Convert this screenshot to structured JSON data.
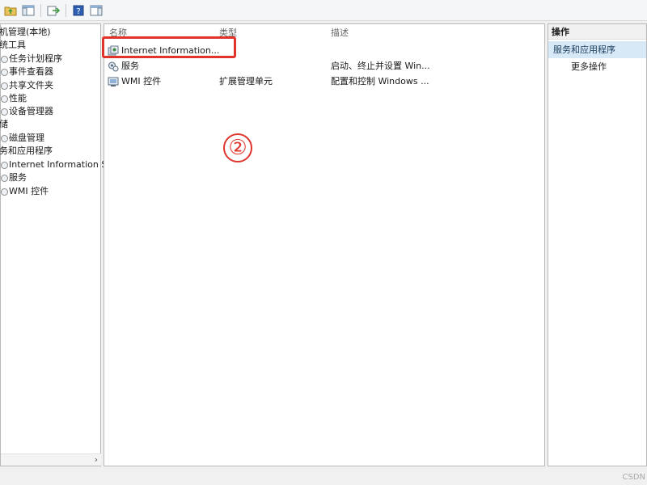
{
  "toolbar": {
    "icons": [
      "up-folder-icon",
      "console-tree-icon",
      "export-list-icon",
      "help-icon",
      "show-hide-action-pane-icon"
    ]
  },
  "tree": {
    "items": [
      {
        "label": "机管理(本地)",
        "icon": ""
      },
      {
        "label": "统工具",
        "icon": ""
      },
      {
        "label": "任务计划程序",
        "icon": "clock-icon"
      },
      {
        "label": "事件查看器",
        "icon": "event-log-icon"
      },
      {
        "label": "共享文件夹",
        "icon": "shared-folder-icon"
      },
      {
        "label": "性能",
        "icon": "performance-icon"
      },
      {
        "label": "设备管理器",
        "icon": "device-manager-icon"
      },
      {
        "label": "储",
        "icon": ""
      },
      {
        "label": "磁盘管理",
        "icon": "disk-icon"
      },
      {
        "label": "务和应用程序",
        "icon": ""
      },
      {
        "label": "Internet Information S",
        "icon": "iis-icon"
      },
      {
        "label": "服务",
        "icon": "services-icon"
      },
      {
        "label": "WMI 控件",
        "icon": "wmi-icon"
      }
    ],
    "scroll_arrow": "›"
  },
  "main": {
    "columns": {
      "name": "名称",
      "type": "类型",
      "desc": "描述"
    },
    "rows": [
      {
        "name": "Internet Information...",
        "type": "",
        "desc": "",
        "icon": "iis-icon"
      },
      {
        "name": "服务",
        "type": "",
        "desc": "启动、终止并设置 Win...",
        "icon": "services-icon"
      },
      {
        "name": "WMI 控件",
        "type": "扩展管理单元",
        "desc": "配置和控制 Windows ...",
        "icon": "wmi-icon"
      }
    ]
  },
  "annotation": {
    "step": "②",
    "color": "#e0352b"
  },
  "actions": {
    "title": "操作",
    "section": "服务和应用程序",
    "more": "更多操作"
  },
  "watermark": "CSDN"
}
